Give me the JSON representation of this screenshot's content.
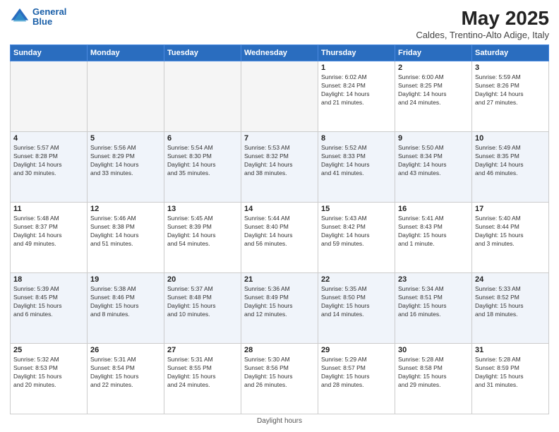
{
  "header": {
    "logo_line1": "General",
    "logo_line2": "Blue",
    "month_year": "May 2025",
    "location": "Caldes, Trentino-Alto Adige, Italy"
  },
  "days_of_week": [
    "Sunday",
    "Monday",
    "Tuesday",
    "Wednesday",
    "Thursday",
    "Friday",
    "Saturday"
  ],
  "weeks": [
    [
      {
        "day": "",
        "info": ""
      },
      {
        "day": "",
        "info": ""
      },
      {
        "day": "",
        "info": ""
      },
      {
        "day": "",
        "info": ""
      },
      {
        "day": "1",
        "info": "Sunrise: 6:02 AM\nSunset: 8:24 PM\nDaylight: 14 hours\nand 21 minutes."
      },
      {
        "day": "2",
        "info": "Sunrise: 6:00 AM\nSunset: 8:25 PM\nDaylight: 14 hours\nand 24 minutes."
      },
      {
        "day": "3",
        "info": "Sunrise: 5:59 AM\nSunset: 8:26 PM\nDaylight: 14 hours\nand 27 minutes."
      }
    ],
    [
      {
        "day": "4",
        "info": "Sunrise: 5:57 AM\nSunset: 8:28 PM\nDaylight: 14 hours\nand 30 minutes."
      },
      {
        "day": "5",
        "info": "Sunrise: 5:56 AM\nSunset: 8:29 PM\nDaylight: 14 hours\nand 33 minutes."
      },
      {
        "day": "6",
        "info": "Sunrise: 5:54 AM\nSunset: 8:30 PM\nDaylight: 14 hours\nand 35 minutes."
      },
      {
        "day": "7",
        "info": "Sunrise: 5:53 AM\nSunset: 8:32 PM\nDaylight: 14 hours\nand 38 minutes."
      },
      {
        "day": "8",
        "info": "Sunrise: 5:52 AM\nSunset: 8:33 PM\nDaylight: 14 hours\nand 41 minutes."
      },
      {
        "day": "9",
        "info": "Sunrise: 5:50 AM\nSunset: 8:34 PM\nDaylight: 14 hours\nand 43 minutes."
      },
      {
        "day": "10",
        "info": "Sunrise: 5:49 AM\nSunset: 8:35 PM\nDaylight: 14 hours\nand 46 minutes."
      }
    ],
    [
      {
        "day": "11",
        "info": "Sunrise: 5:48 AM\nSunset: 8:37 PM\nDaylight: 14 hours\nand 49 minutes."
      },
      {
        "day": "12",
        "info": "Sunrise: 5:46 AM\nSunset: 8:38 PM\nDaylight: 14 hours\nand 51 minutes."
      },
      {
        "day": "13",
        "info": "Sunrise: 5:45 AM\nSunset: 8:39 PM\nDaylight: 14 hours\nand 54 minutes."
      },
      {
        "day": "14",
        "info": "Sunrise: 5:44 AM\nSunset: 8:40 PM\nDaylight: 14 hours\nand 56 minutes."
      },
      {
        "day": "15",
        "info": "Sunrise: 5:43 AM\nSunset: 8:42 PM\nDaylight: 14 hours\nand 59 minutes."
      },
      {
        "day": "16",
        "info": "Sunrise: 5:41 AM\nSunset: 8:43 PM\nDaylight: 15 hours\nand 1 minute."
      },
      {
        "day": "17",
        "info": "Sunrise: 5:40 AM\nSunset: 8:44 PM\nDaylight: 15 hours\nand 3 minutes."
      }
    ],
    [
      {
        "day": "18",
        "info": "Sunrise: 5:39 AM\nSunset: 8:45 PM\nDaylight: 15 hours\nand 6 minutes."
      },
      {
        "day": "19",
        "info": "Sunrise: 5:38 AM\nSunset: 8:46 PM\nDaylight: 15 hours\nand 8 minutes."
      },
      {
        "day": "20",
        "info": "Sunrise: 5:37 AM\nSunset: 8:48 PM\nDaylight: 15 hours\nand 10 minutes."
      },
      {
        "day": "21",
        "info": "Sunrise: 5:36 AM\nSunset: 8:49 PM\nDaylight: 15 hours\nand 12 minutes."
      },
      {
        "day": "22",
        "info": "Sunrise: 5:35 AM\nSunset: 8:50 PM\nDaylight: 15 hours\nand 14 minutes."
      },
      {
        "day": "23",
        "info": "Sunrise: 5:34 AM\nSunset: 8:51 PM\nDaylight: 15 hours\nand 16 minutes."
      },
      {
        "day": "24",
        "info": "Sunrise: 5:33 AM\nSunset: 8:52 PM\nDaylight: 15 hours\nand 18 minutes."
      }
    ],
    [
      {
        "day": "25",
        "info": "Sunrise: 5:32 AM\nSunset: 8:53 PM\nDaylight: 15 hours\nand 20 minutes."
      },
      {
        "day": "26",
        "info": "Sunrise: 5:31 AM\nSunset: 8:54 PM\nDaylight: 15 hours\nand 22 minutes."
      },
      {
        "day": "27",
        "info": "Sunrise: 5:31 AM\nSunset: 8:55 PM\nDaylight: 15 hours\nand 24 minutes."
      },
      {
        "day": "28",
        "info": "Sunrise: 5:30 AM\nSunset: 8:56 PM\nDaylight: 15 hours\nand 26 minutes."
      },
      {
        "day": "29",
        "info": "Sunrise: 5:29 AM\nSunset: 8:57 PM\nDaylight: 15 hours\nand 28 minutes."
      },
      {
        "day": "30",
        "info": "Sunrise: 5:28 AM\nSunset: 8:58 PM\nDaylight: 15 hours\nand 29 minutes."
      },
      {
        "day": "31",
        "info": "Sunrise: 5:28 AM\nSunset: 8:59 PM\nDaylight: 15 hours\nand 31 minutes."
      }
    ]
  ],
  "footer": {
    "note": "Daylight hours"
  }
}
